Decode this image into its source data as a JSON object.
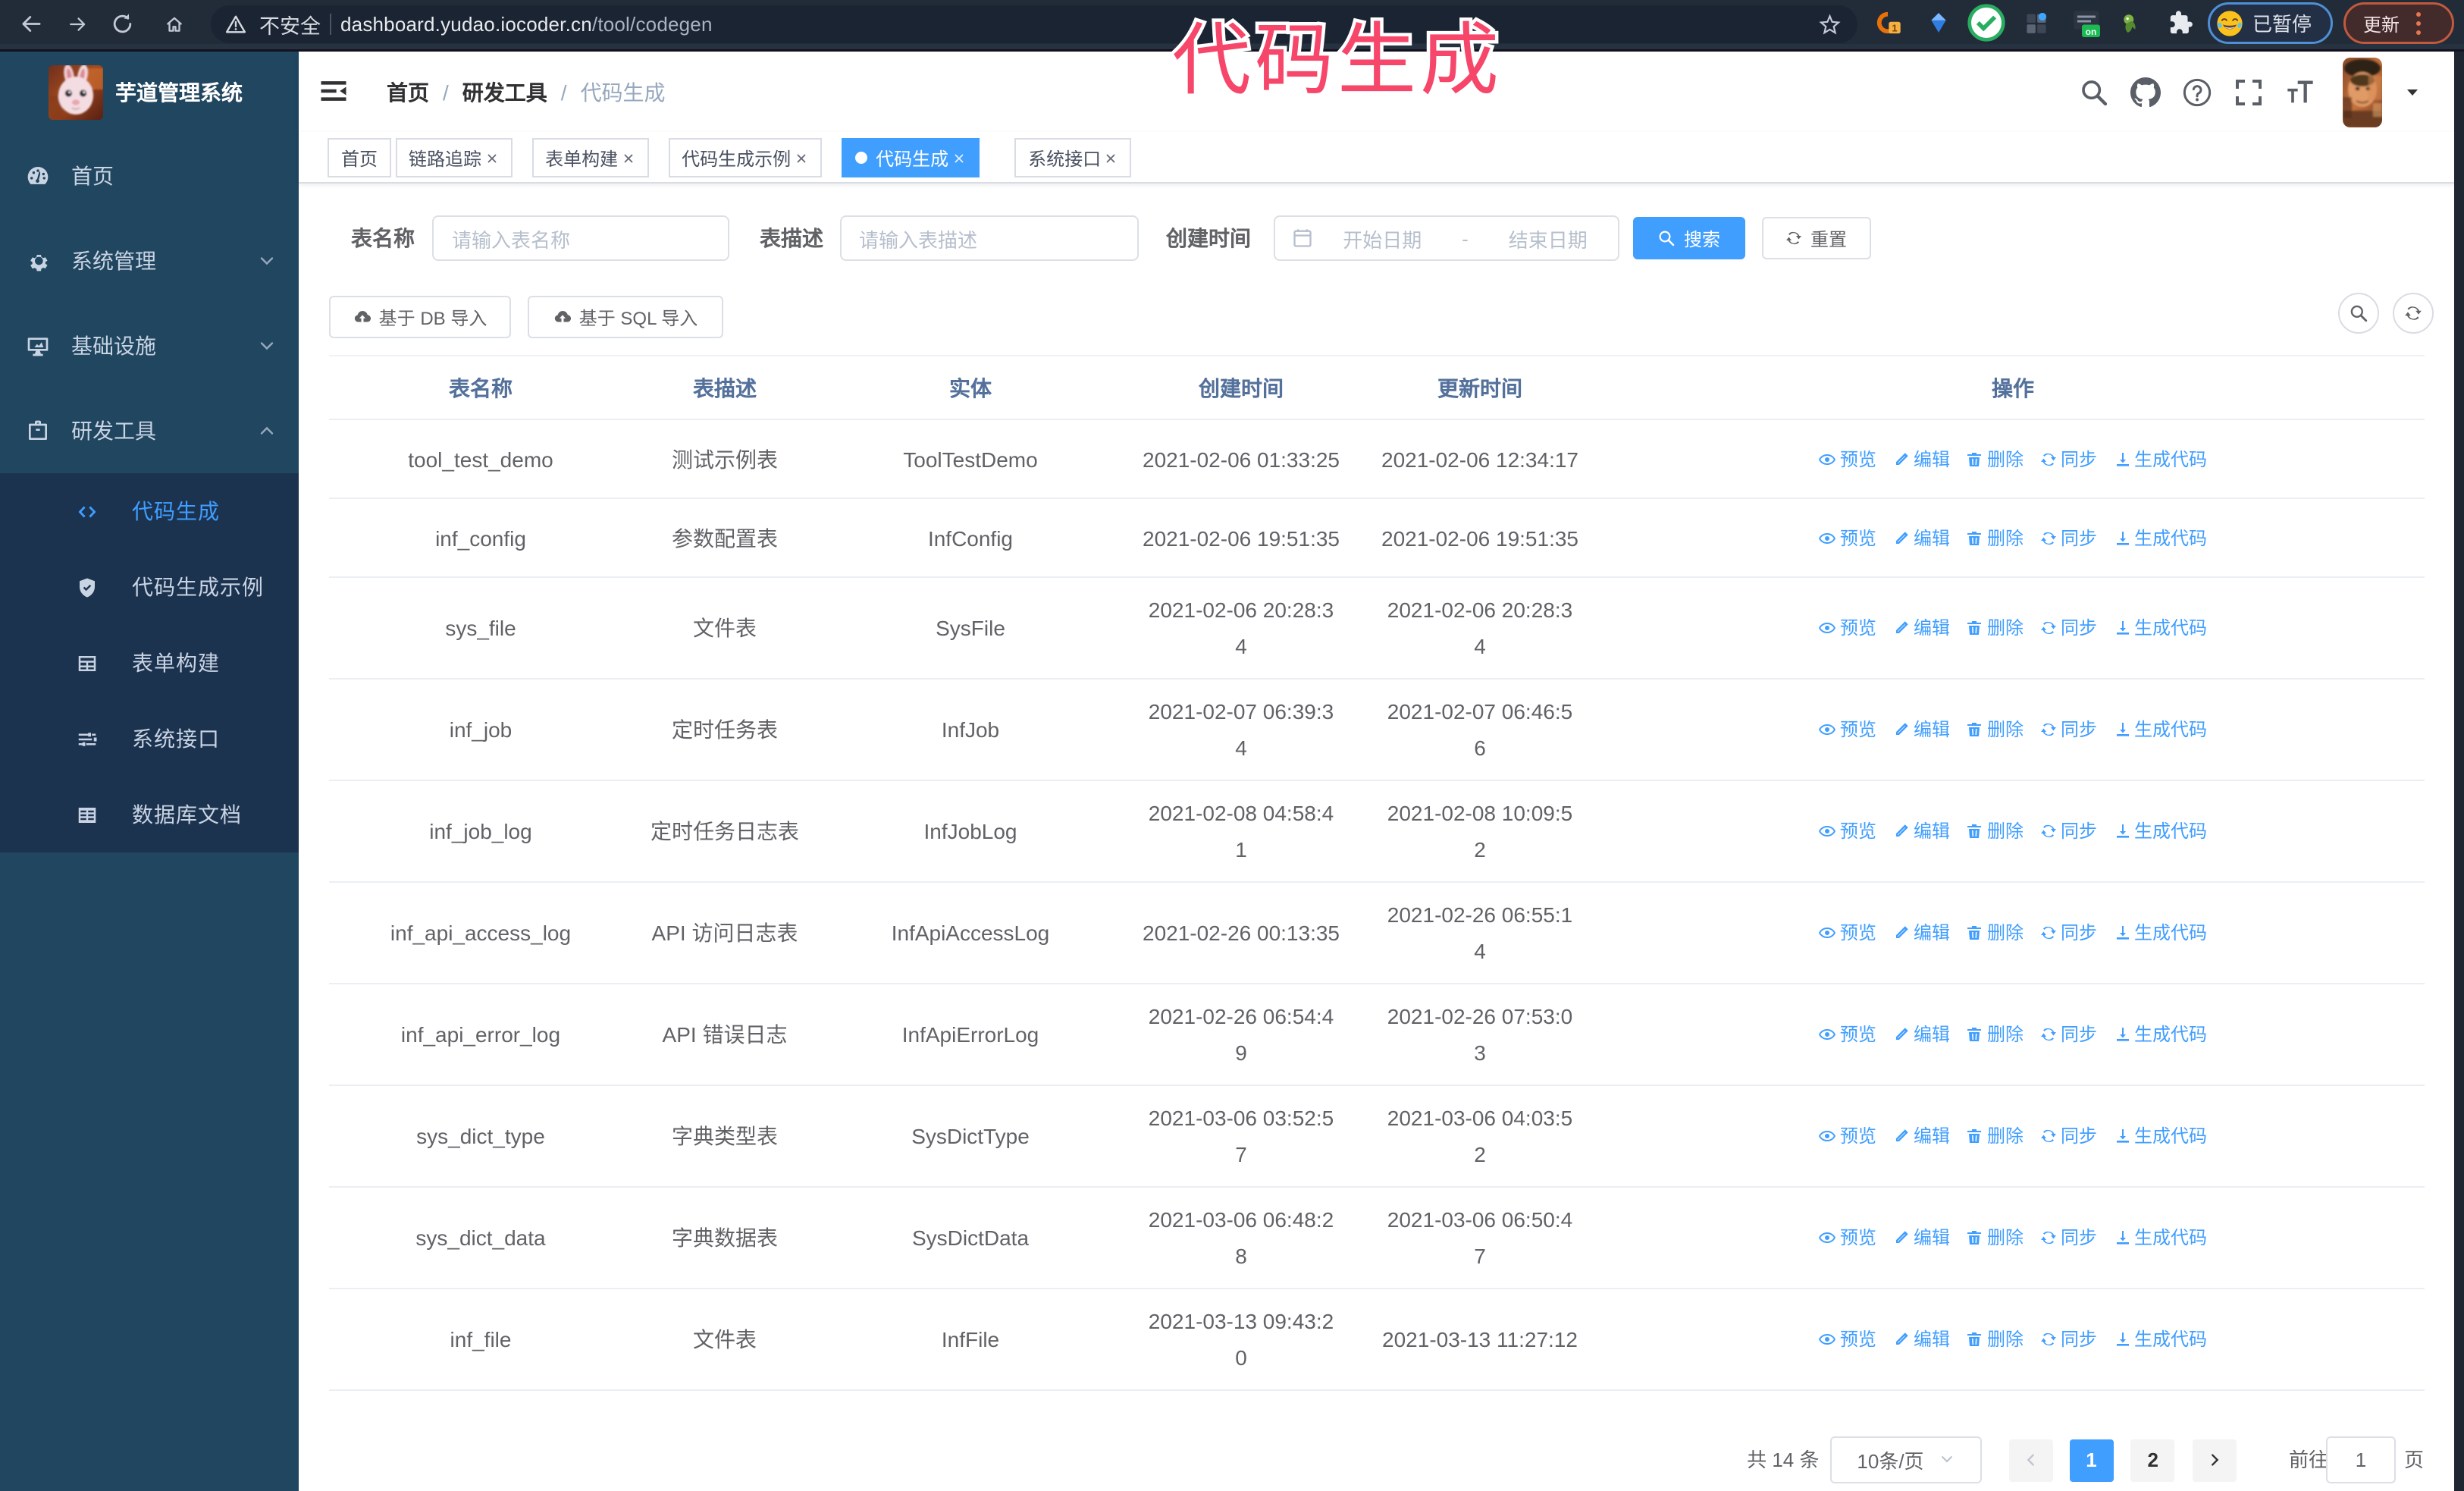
{
  "chrome": {
    "security_label": "不安全",
    "url_host": "dashboard.yudao.iocoder.cn",
    "url_path": "/tool/codegen",
    "extension_badge": "1",
    "extension_on_label": "on",
    "profile_label": "已暂停",
    "update_label": "更新"
  },
  "annotation": {
    "text": "代码生成",
    "color": "#f6466a"
  },
  "sidebar": {
    "logo_title": "芋道管理系统",
    "items": [
      {
        "icon": "dashboard",
        "label": "首页",
        "arrow": ""
      },
      {
        "icon": "gear",
        "label": "系统管理",
        "arrow": "down"
      },
      {
        "icon": "monitor",
        "label": "基础设施",
        "arrow": "down"
      },
      {
        "icon": "briefcase",
        "label": "研发工具",
        "arrow": "up"
      }
    ],
    "subitems": [
      {
        "icon": "code",
        "label": "代码生成",
        "active": true
      },
      {
        "icon": "example",
        "label": "代码生成示例",
        "active": false
      },
      {
        "icon": "form",
        "label": "表单构建",
        "active": false
      },
      {
        "icon": "sliders",
        "label": "系统接口",
        "active": false
      },
      {
        "icon": "dbdoc",
        "label": "数据库文档",
        "active": false
      }
    ]
  },
  "navbar": {
    "breadcrumb": [
      "首页",
      "研发工具",
      "代码生成"
    ],
    "icons": [
      "search",
      "github",
      "question",
      "fullscreen",
      "fontsize"
    ]
  },
  "tags": [
    {
      "label": "首页",
      "closable": false,
      "active": false,
      "ml": 19.0
    },
    {
      "label": "链路追踪",
      "closable": true,
      "active": false,
      "ml": 2.5
    },
    {
      "label": "表单构建",
      "closable": true,
      "active": false,
      "ml": 13.0
    },
    {
      "label": "代码生成示例",
      "closable": true,
      "active": false,
      "ml": 13.0
    },
    {
      "label": "代码生成",
      "closable": true,
      "active": true,
      "ml": 13.0
    },
    {
      "label": "系统接口",
      "closable": true,
      "active": false,
      "ml": 23.5
    }
  ],
  "filters": {
    "name_label": "表名称",
    "name_placeholder": "请输入表名称",
    "desc_label": "表描述",
    "desc_placeholder": "请输入表描述",
    "date_label": "创建时间",
    "date_start_placeholder": "开始日期",
    "date_separator": "-",
    "date_end_placeholder": "结束日期",
    "search_label": "搜索",
    "reset_label": "重置"
  },
  "toolbar": {
    "import_db_label": "基于 DB 导入",
    "import_sql_label": "基于 SQL 导入"
  },
  "table": {
    "headers": [
      "表名称",
      "表描述",
      "实体",
      "创建时间",
      "更新时间",
      "操作"
    ],
    "actions": [
      {
        "icon": "eye",
        "label": "预览"
      },
      {
        "icon": "edit",
        "label": "编辑"
      },
      {
        "icon": "trash",
        "label": "删除"
      },
      {
        "icon": "sync",
        "label": "同步"
      },
      {
        "icon": "download",
        "label": "生成代码"
      }
    ],
    "rows": [
      {
        "name": "tool_test_demo",
        "desc": "测试示例表",
        "entity": "ToolTestDemo",
        "created": [
          "2021-02-06 01:33:25"
        ],
        "updated": [
          "2021-02-06 12:34:17"
        ]
      },
      {
        "name": "inf_config",
        "desc": "参数配置表",
        "entity": "InfConfig",
        "created": [
          "2021-02-06 19:51:35"
        ],
        "updated": [
          "2021-02-06 19:51:35"
        ]
      },
      {
        "name": "sys_file",
        "desc": "文件表",
        "entity": "SysFile",
        "created": [
          "2021-02-06 20:28:3",
          "4"
        ],
        "updated": [
          "2021-02-06 20:28:3",
          "4"
        ]
      },
      {
        "name": "inf_job",
        "desc": "定时任务表",
        "entity": "InfJob",
        "created": [
          "2021-02-07 06:39:3",
          "4"
        ],
        "updated": [
          "2021-02-07 06:46:5",
          "6"
        ]
      },
      {
        "name": "inf_job_log",
        "desc": "定时任务日志表",
        "entity": "InfJobLog",
        "created": [
          "2021-02-08 04:58:4",
          "1"
        ],
        "updated": [
          "2021-02-08 10:09:5",
          "2"
        ]
      },
      {
        "name": "inf_api_access_log",
        "desc": "API 访问日志表",
        "entity": "InfApiAccessLog",
        "created": [
          "2021-02-26 00:13:35"
        ],
        "updated": [
          "2021-02-26 06:55:1",
          "4"
        ]
      },
      {
        "name": "inf_api_error_log",
        "desc": "API 错误日志",
        "entity": "InfApiErrorLog",
        "created": [
          "2021-02-26 06:54:4",
          "9"
        ],
        "updated": [
          "2021-02-26 07:53:0",
          "3"
        ]
      },
      {
        "name": "sys_dict_type",
        "desc": "字典类型表",
        "entity": "SysDictType",
        "created": [
          "2021-03-06 03:52:5",
          "7"
        ],
        "updated": [
          "2021-03-06 04:03:5",
          "2"
        ]
      },
      {
        "name": "sys_dict_data",
        "desc": "字典数据表",
        "entity": "SysDictData",
        "created": [
          "2021-03-06 06:48:2",
          "8"
        ],
        "updated": [
          "2021-03-06 06:50:4",
          "7"
        ]
      },
      {
        "name": "inf_file",
        "desc": "文件表",
        "entity": "InfFile",
        "created": [
          "2021-03-13 09:43:2",
          "0"
        ],
        "updated": [
          "2021-03-13 11:27:12"
        ]
      }
    ]
  },
  "pagination": {
    "total_label": "共 14 条",
    "page_size_label": "10条/页",
    "pages": [
      "1",
      "2"
    ],
    "current_page": "1",
    "jumper_label": "前往",
    "jumper_value": "1",
    "jumper_suffix": "页"
  }
}
